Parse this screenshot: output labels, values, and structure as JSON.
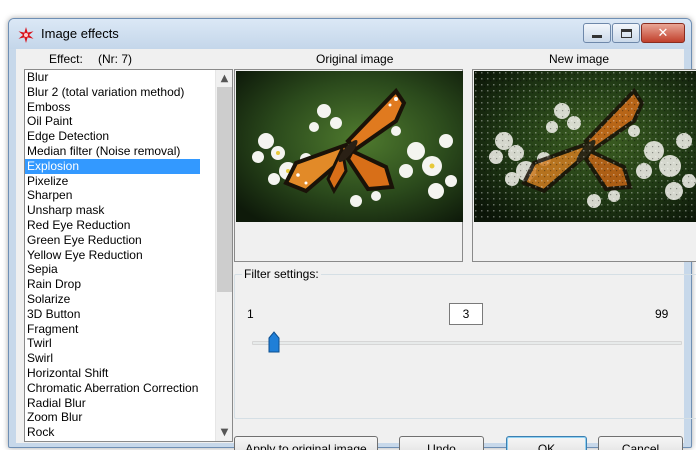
{
  "window": {
    "title": "Image effects",
    "icon": "red-star-icon",
    "controls": [
      "minimize-icon",
      "maximize-icon",
      "close-icon"
    ]
  },
  "labels": {
    "effect": "Effect:",
    "effect_nr": "(Nr: 7)",
    "original_image": "Original image",
    "new_image": "New image"
  },
  "effects": {
    "items": [
      "Blur",
      "Blur 2 (total variation method)",
      "Emboss",
      "Oil Paint",
      "Edge Detection",
      "Median filter (Noise removal)",
      "Explosion",
      "Pixelize",
      "Sharpen",
      "Unsharp mask",
      "Red Eye Reduction",
      "Green Eye Reduction",
      "Yellow Eye Reduction",
      "Sepia",
      "Rain Drop",
      "Solarize",
      "3D Button",
      "Fragment",
      "Twirl",
      "Swirl",
      "Horizontal Shift",
      "Chromatic Aberration Correction",
      "Radial Blur",
      "Zoom Blur",
      "Rock"
    ],
    "selected": "Explosion"
  },
  "filter": {
    "legend": "Filter settings:",
    "min": "1",
    "max": "99",
    "value": "3",
    "slider_level": 3
  },
  "buttons": {
    "apply": "Apply to original image",
    "undo": "Undo",
    "ok": "OK",
    "cancel": "Cancel"
  },
  "colors": {
    "selection": "#3399ff",
    "window_frame": "#c7d8ea",
    "close_button": "#c1402c"
  }
}
